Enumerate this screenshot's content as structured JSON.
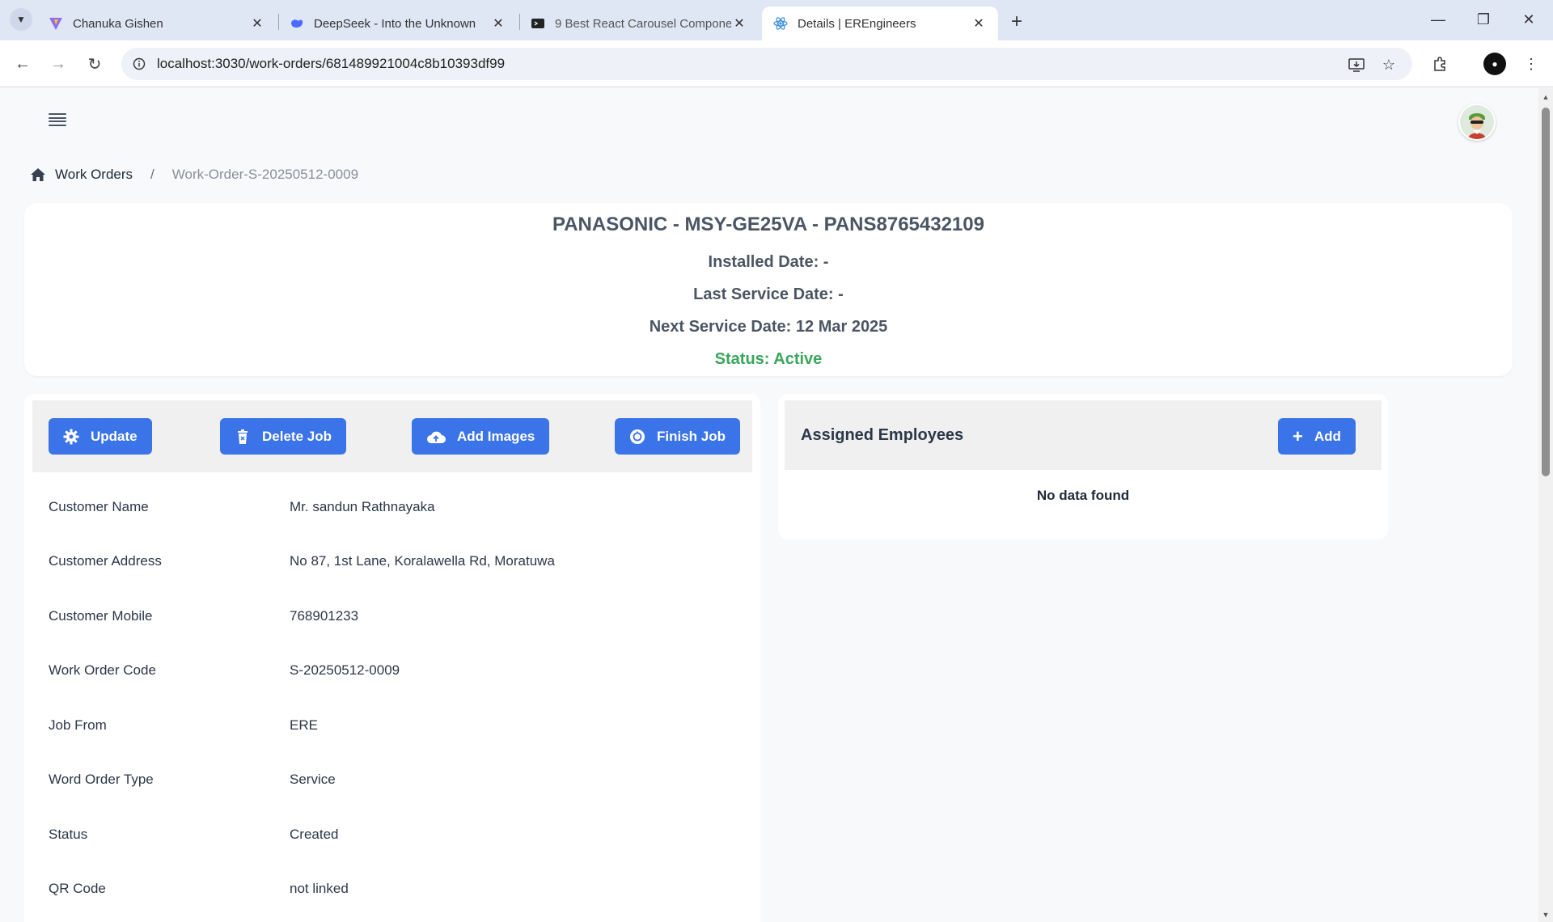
{
  "browser": {
    "tabs": [
      {
        "title": "Chanuka Gishen",
        "favicon": "vite-icon"
      },
      {
        "title": "DeepSeek - Into the Unknown",
        "favicon": "deepseek-icon"
      },
      {
        "title": "9 Best React Carousel Componen",
        "favicon": "terminal-icon"
      },
      {
        "title": "Details | EREngineers",
        "favicon": "react-icon",
        "active": true
      }
    ],
    "url": "localhost:3030/work-orders/681489921004c8b10393df99"
  },
  "breadcrumb": {
    "home_label": "Work Orders",
    "separator": "/",
    "current": "Work-Order-S-20250512-0009"
  },
  "summary": {
    "title": "PANASONIC - MSY-GE25VA - PANS8765432109",
    "installed_date": "Installed Date: -",
    "last_service_date": "Last Service Date: -",
    "next_service_date": "Next Service Date: 12 Mar 2025",
    "status": "Status: Active"
  },
  "actions": {
    "update": "Update",
    "delete_job": "Delete Job",
    "add_images": "Add Images",
    "finish_job": "Finish Job"
  },
  "details": [
    {
      "label": "Customer Name",
      "value": "Mr. sandun Rathnayaka"
    },
    {
      "label": "Customer Address",
      "value": "No 87, 1st Lane, Koralawella Rd, Moratuwa"
    },
    {
      "label": "Customer Mobile",
      "value": "768901233"
    },
    {
      "label": "Work Order Code",
      "value": "S-20250512-0009"
    },
    {
      "label": "Job From",
      "value": "ERE"
    },
    {
      "label": "Word Order Type",
      "value": "Service"
    },
    {
      "label": "Status",
      "value": "Created"
    },
    {
      "label": "QR Code",
      "value": "not linked"
    }
  ],
  "employees": {
    "title": "Assigned Employees",
    "add_label": "Add",
    "empty_text": "No data found"
  },
  "colors": {
    "primary": "#3b73e8",
    "status_active": "#3aa55d"
  }
}
